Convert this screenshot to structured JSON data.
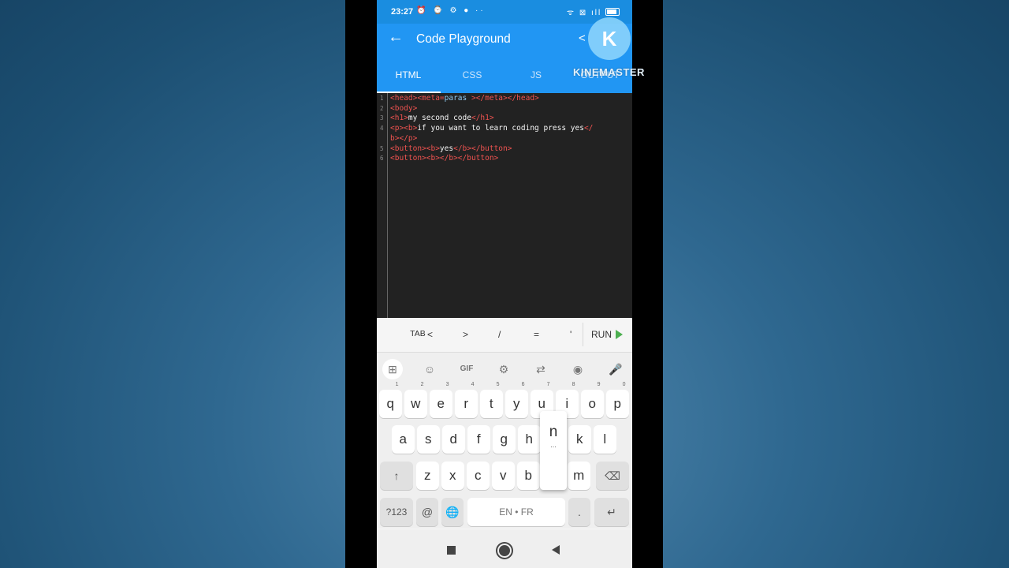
{
  "status": {
    "time": "23:27",
    "left_icons": "⏰ ⌚ ⚙ ● ··",
    "right_icons": "ᯤ ⊠ ıll"
  },
  "appbar": {
    "back_icon": "←",
    "title": "Code Playground",
    "share_icon": "<"
  },
  "tabs": [
    {
      "label": "HTML",
      "active": true
    },
    {
      "label": "CSS"
    },
    {
      "label": "JS"
    },
    {
      "label": "OUTPUT"
    }
  ],
  "watermark": {
    "logo": "K",
    "text": "KINEMASTER"
  },
  "editor": {
    "lines": [
      {
        "n": "1",
        "parts": [
          [
            "tag",
            "<head><meta="
          ],
          [
            "val",
            "paras"
          ],
          [
            "tag",
            " ></meta></head>"
          ]
        ]
      },
      {
        "n": "2",
        "parts": [
          [
            "tag",
            "<body>"
          ]
        ]
      },
      {
        "n": "3",
        "parts": [
          [
            "tag",
            "<h1>"
          ],
          [
            "attr",
            "my second code"
          ],
          [
            "tag",
            "</h1>"
          ]
        ]
      },
      {
        "n": "4",
        "parts": [
          [
            "tag",
            "<p><b>"
          ],
          [
            "attr",
            "if you want to learn coding press yes"
          ],
          [
            "tag",
            "</"
          ]
        ]
      },
      {
        "n": "",
        "parts": [
          [
            "tag",
            "b></p>"
          ]
        ]
      },
      {
        "n": "5",
        "parts": [
          [
            "tag",
            "<button><b>"
          ],
          [
            "attr",
            "yes"
          ],
          [
            "tag",
            "</b></button>"
          ]
        ]
      },
      {
        "n": "6",
        "parts": [
          [
            "tag",
            "<button><b></b></button>"
          ]
        ]
      }
    ]
  },
  "shortcuts": {
    "tab": "TAB",
    "lt": "<",
    "gt": ">",
    "slash": "/",
    "eq": "=",
    "quote": "'",
    "run": "RUN"
  },
  "keyboard": {
    "toolbar_icons": [
      "⊞",
      "☺",
      "GIF",
      "⚙",
      "⇄",
      "◉",
      "🎤"
    ],
    "row1": [
      "q",
      "w",
      "e",
      "r",
      "t",
      "y",
      "u",
      "i",
      "o",
      "p"
    ],
    "row1_nums": [
      "1",
      "2",
      "3",
      "4",
      "5",
      "6",
      "7",
      "8",
      "9",
      "0"
    ],
    "row2": [
      "a",
      "s",
      "d",
      "f",
      "g",
      "h",
      "j",
      "k",
      "l"
    ],
    "row3": [
      "z",
      "x",
      "c",
      "v",
      "b",
      "n",
      "m"
    ],
    "shift": "↑",
    "backspace": "⌫",
    "sym": "?123",
    "at": "@",
    "globe": "🌐",
    "space": "EN • FR",
    "period": ".",
    "enter": "↵",
    "popup_letter": "n",
    "popup_dots": "..."
  }
}
